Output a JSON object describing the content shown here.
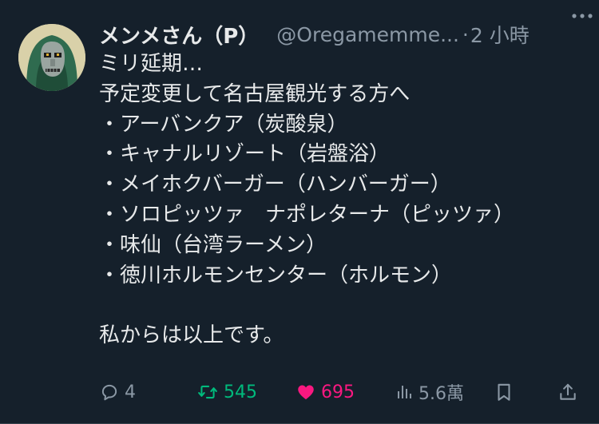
{
  "tweet": {
    "display_name": "メンメさん（P）",
    "handle": "@Oregamemme...",
    "separator": "·",
    "time": "2 小時",
    "lines": [
      "ミリ延期…",
      "予定変更して名古屋観光する方へ",
      "・アーバンクア（炭酸泉）",
      "・キャナルリゾート（岩盤浴）",
      "・メイホクバーガー（ハンバーガー）",
      "・ソロピッツァ　ナポレターナ（ピッツァ）",
      "・味仙（台湾ラーメン）",
      "・徳川ホルモンセンター（ホルモン）",
      "",
      "私からは以上です。"
    ]
  },
  "actions": {
    "replies": "4",
    "retweets": "545",
    "likes": "695",
    "views": "5.6萬"
  },
  "icons": {
    "more": "more-horizontal-icon",
    "reply": "reply-bubble-icon",
    "retweet": "retweet-icon",
    "like": "heart-icon",
    "views": "views-bar-chart-icon",
    "bookmark": "bookmark-icon",
    "share": "share-upload-icon"
  },
  "colors": {
    "background": "#15202b",
    "text": "#e7e9ea",
    "secondary": "#8b98a5",
    "retweet_active": "#00ba7c",
    "like_active": "#f91880"
  }
}
